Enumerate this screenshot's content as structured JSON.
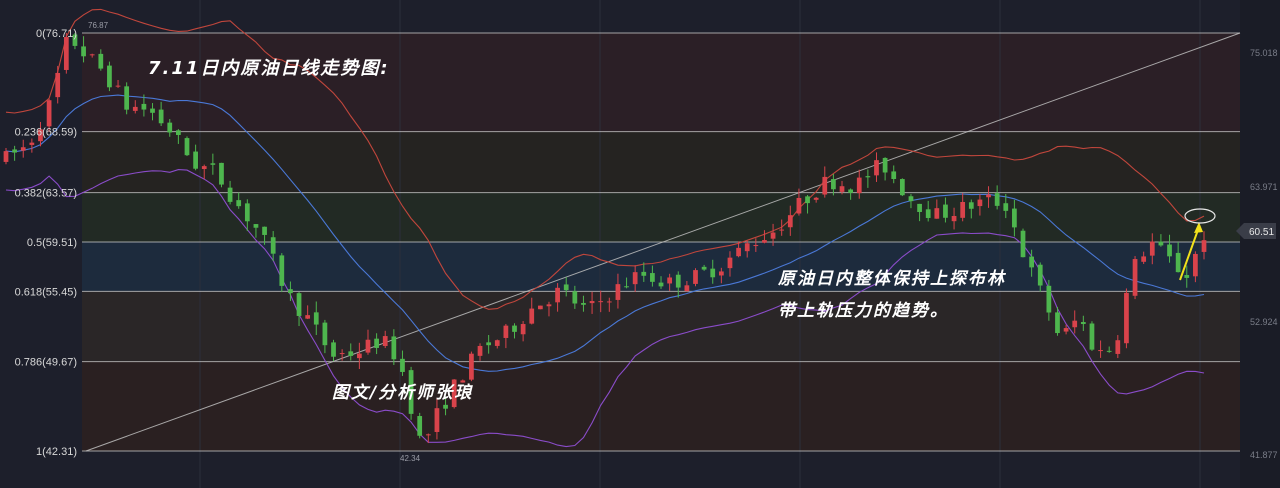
{
  "chart_data": {
    "type": "candlestick",
    "title": "7.11日内原油日线走势图:",
    "annotations": {
      "trend_line1": "原油日内整体保持上探布林",
      "trend_line2": "带上轨压力的趋势。",
      "author": "图文/分析师张琅"
    },
    "fibonacci_levels": [
      {
        "label": "0(76.71)",
        "ratio": 0,
        "price": 76.71
      },
      {
        "label": "0.236(68.59)",
        "ratio": 0.236,
        "price": 68.59
      },
      {
        "label": "0.382(63.57)",
        "ratio": 0.382,
        "price": 63.57
      },
      {
        "label": "0.5(59.51)",
        "ratio": 0.5,
        "price": 59.51
      },
      {
        "label": "0.618(55.45)",
        "ratio": 0.618,
        "price": 55.45
      },
      {
        "label": "0.786(49.67)",
        "ratio": 0.786,
        "price": 49.67
      },
      {
        "label": "1(42.31)",
        "ratio": 1,
        "price": 42.31
      }
    ],
    "right_axis_ticks": [
      "75.018",
      "63.971",
      "52.924",
      "41.877"
    ],
    "current_price": "60.51",
    "high_label": "76.87",
    "low_label": "42.34",
    "candle_count": 140,
    "colors": {
      "up": "#d9434b",
      "down": "#4eb64e",
      "upper_band": "#c0463c",
      "middle_band": "#4a78d6",
      "lower_band": "#8a4cc9",
      "fib_line": "#cfcfcf",
      "diagonal": "#bfbfbf",
      "arrow": "#f2e11b"
    }
  }
}
